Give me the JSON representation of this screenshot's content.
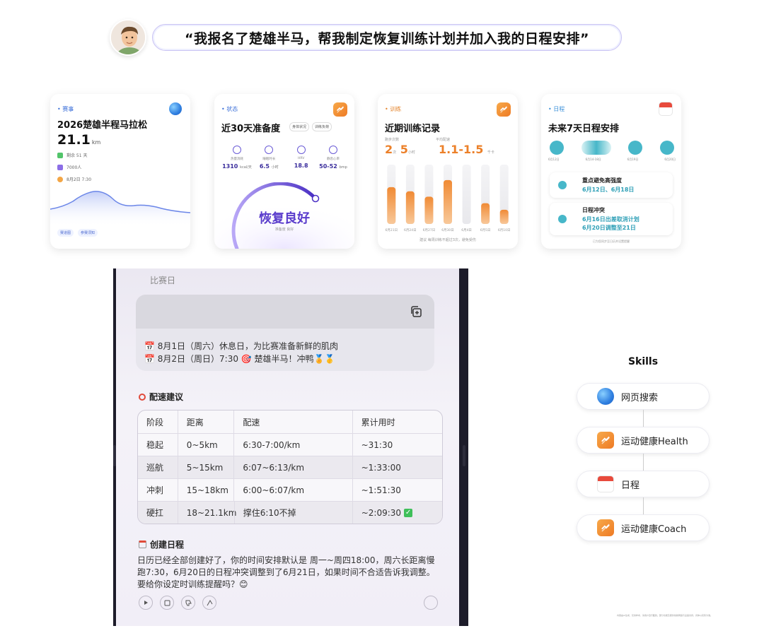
{
  "prompt": {
    "text": "“我报名了楚雄半马，帮我制定恢复训练计划并加入我的日程安排”"
  },
  "colors": {
    "accent_purple": "#5a3ccc",
    "orange": "#ec8029",
    "teal": "#47b7c9",
    "blue": "#2f7fe0"
  },
  "icons": {
    "avatar": "user-avatar",
    "globe": "globe-icon",
    "health": "health-app-icon",
    "calendar": "calendar-icon"
  },
  "card1": {
    "tag": "• 赛事",
    "title": "2026楚雄半程马拉松",
    "distance": "21.1",
    "distance_unit": "km",
    "meta": [
      "剩余 51 天",
      "7000人",
      "8月2日 7:30"
    ],
    "chips": [
      "赛道图",
      "参赛须知"
    ]
  },
  "card2": {
    "tag": "• 状态",
    "title": "近30天准备度",
    "pills": [
      "身体状况",
      "训练负荷"
    ],
    "metrics": [
      {
        "label": "热量消耗",
        "value": "1310",
        "unit": "kcal/天"
      },
      {
        "label": "睡眠时长",
        "value": "6.5",
        "unit": "小时"
      },
      {
        "label": "HRV",
        "value": "18.8",
        "unit": ""
      },
      {
        "label": "静息心率",
        "value": "50-52",
        "unit": "bmp"
      }
    ],
    "status": "恢复良好",
    "status_sub": "准备度 良好"
  },
  "card3": {
    "tag": "• 训练",
    "title": "近期训练记录",
    "label_a": "跑步次数",
    "label_b": "平均配速",
    "value_a1": "2",
    "unit_a1": "次",
    "value_a2": "5",
    "unit_a2": "小时",
    "value_b": "1.1-1.5",
    "unit_b": "千卡",
    "bar_dates": [
      "6月21日",
      "6月24日",
      "6月27日",
      "6月30日",
      "6月4日",
      "6月5日",
      "6月10日"
    ],
    "bar_values": [
      0.62,
      0.55,
      0.46,
      0.74,
      0,
      0.35,
      0.24
    ],
    "footnote": "建议 每周训练不超过3次，避免受伤"
  },
  "card4": {
    "tag": "• 日程",
    "title": "未来7天日程安排",
    "dates": [
      "6月12日",
      "6月14-18日",
      "6月19日",
      "6月20日"
    ],
    "item1_title": "重点避免高强度",
    "item1_detail": "6月12日、6月18日",
    "item2_title": "日程冲突",
    "item2_line1": "6月16日出差取消计划",
    "item2_line2": "6月20日调整至21日",
    "footnote": "已为您同步至日历并设置提醒"
  },
  "phone": {
    "header": "比赛日",
    "notice_lines": [
      "📅 8月1日（周六）休息日，为比赛准备新鲜的肌肉",
      "📅 8月2日（周日）7:30 🎯 楚雄半马！冲鸭🏅🥇"
    ],
    "pace_title": "配速建议",
    "pace_headers": [
      "阶段",
      "距离",
      "配速",
      "累计用时"
    ],
    "pace_rows": [
      [
        "稳起",
        "0~5km",
        "6:30-7:00/km",
        "~31:30"
      ],
      [
        "巡航",
        "5~15km",
        "6:07~6:13/km",
        "~1:33:00"
      ],
      [
        "冲刺",
        "15~18km",
        "6:00~6:07/km",
        "~1:51:30"
      ],
      [
        "硬扛",
        "18~21.1km",
        "撑住6:10不掉",
        "~2:09:30"
      ]
    ],
    "schedule_title": "创建日程",
    "schedule_text": "日历已经全部创建好了，你的时间安排默认是 周一~周四18:00，周六长距离慢跑7:30，6月20日的日程冲突调整到了6月21日，如果时间不合适告诉我调整。要给你设定时训练提醒吗？😊"
  },
  "skills": {
    "title": "Skills",
    "items": [
      "网页搜索",
      "运动健康Health",
      "日程",
      "运动健康Coach"
    ]
  },
  "footnote": "内容由AI生成，仅供参考，请用户自行甄别。部分功能及服务依赖网络与设备支持，具体以实际为准。"
}
